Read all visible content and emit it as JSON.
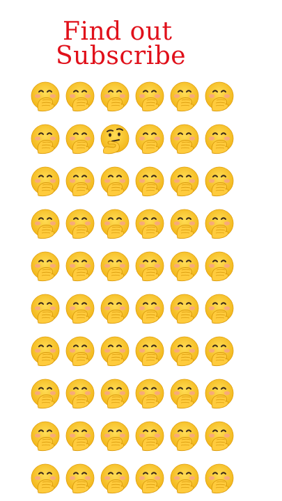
{
  "title": {
    "line1": "Find out",
    "line2": "Subscribe",
    "color": "#e0101a"
  },
  "grid": {
    "rows": 10,
    "columns": 6,
    "default_icon": "hand-over-mouth-emoji-icon",
    "odd_icon": "thinking-face-emoji-icon",
    "odd_position": {
      "row": 2,
      "column": 3
    }
  }
}
